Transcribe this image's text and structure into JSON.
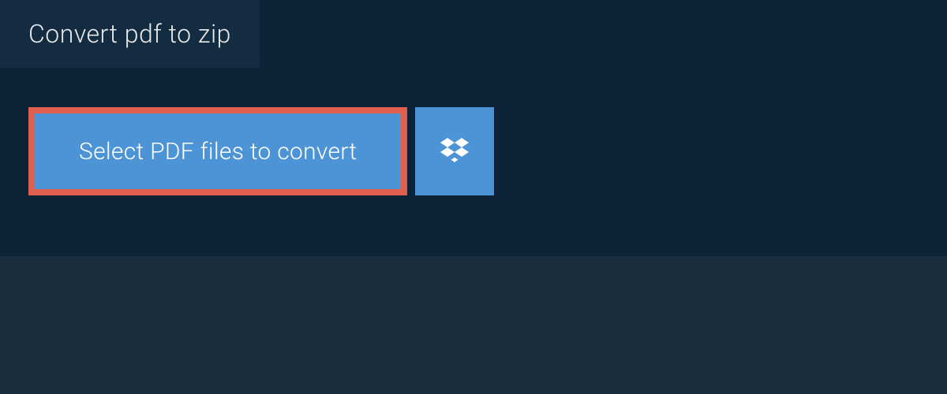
{
  "tab": {
    "label": "Convert pdf to zip"
  },
  "actions": {
    "select_label": "Select PDF files to convert"
  },
  "colors": {
    "panel_bg": "#0d2438",
    "page_bg": "#1a2d3f",
    "button_bg": "#4d94d6",
    "button_border": "#e0604f"
  }
}
